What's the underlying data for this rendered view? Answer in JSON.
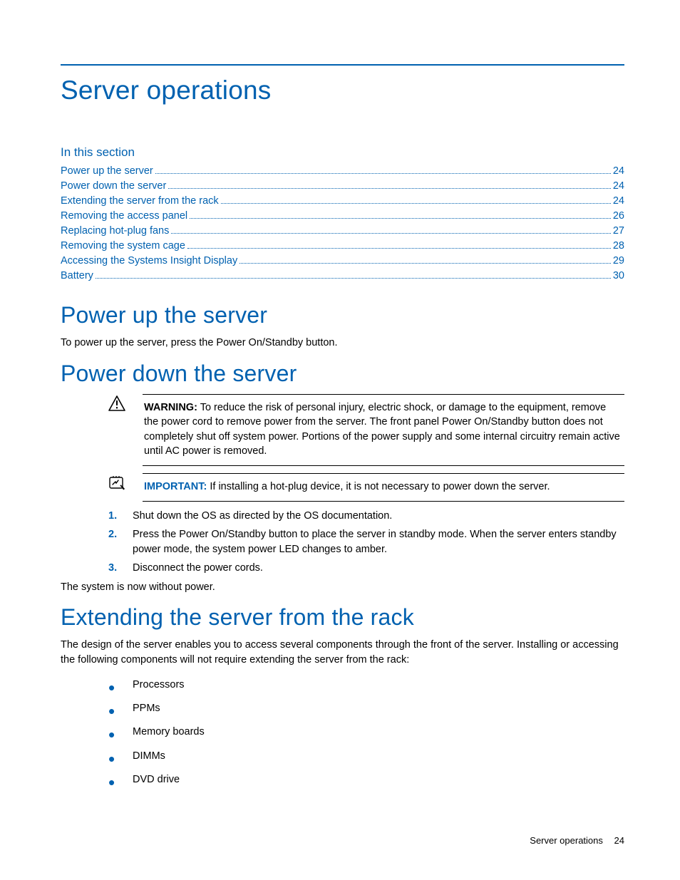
{
  "chapter_title": "Server operations",
  "in_this_section_label": "In this section",
  "toc": [
    {
      "title": "Power up the server",
      "page": "24"
    },
    {
      "title": "Power down the server",
      "page": "24"
    },
    {
      "title": "Extending the server from the rack",
      "page": "24"
    },
    {
      "title": "Removing the access panel",
      "page": "26"
    },
    {
      "title": "Replacing hot-plug fans",
      "page": "27"
    },
    {
      "title": "Removing the system cage",
      "page": "28"
    },
    {
      "title": "Accessing the Systems Insight Display",
      "page": "29"
    },
    {
      "title": "Battery",
      "page": "30"
    }
  ],
  "power_up": {
    "heading": "Power up the server",
    "text": "To power up the server, press the Power On/Standby button."
  },
  "power_down": {
    "heading": "Power down the server",
    "warning_label": "WARNING:",
    "warning_text": "  To reduce the risk of personal injury, electric shock, or damage to the equipment, remove the power cord to remove power from the server. The front panel Power On/Standby button does not completely shut off system power. Portions of the power supply and some internal circuitry remain active until AC power is removed.",
    "important_label": "IMPORTANT:",
    "important_text": "  If installing a hot-plug device, it is not necessary to power down the server.",
    "steps": [
      "Shut down the OS as directed by the OS documentation.",
      "Press the Power On/Standby button to place the server in standby mode. When the server enters standby power mode, the system power LED changes to amber.",
      "Disconnect the power cords."
    ],
    "closing": "The system is now without power."
  },
  "extending": {
    "heading": "Extending the server from the rack",
    "intro": "The design of the server enables you to access several components through the front of the server. Installing or accessing the following components will not require extending the server from the rack:",
    "bullets": [
      "Processors",
      "PPMs",
      "Memory boards",
      "DIMMs",
      "DVD drive"
    ]
  },
  "footer": {
    "section": "Server operations",
    "page": "24"
  },
  "markers": {
    "s1": "1.",
    "s2": "2.",
    "s3": "3."
  }
}
